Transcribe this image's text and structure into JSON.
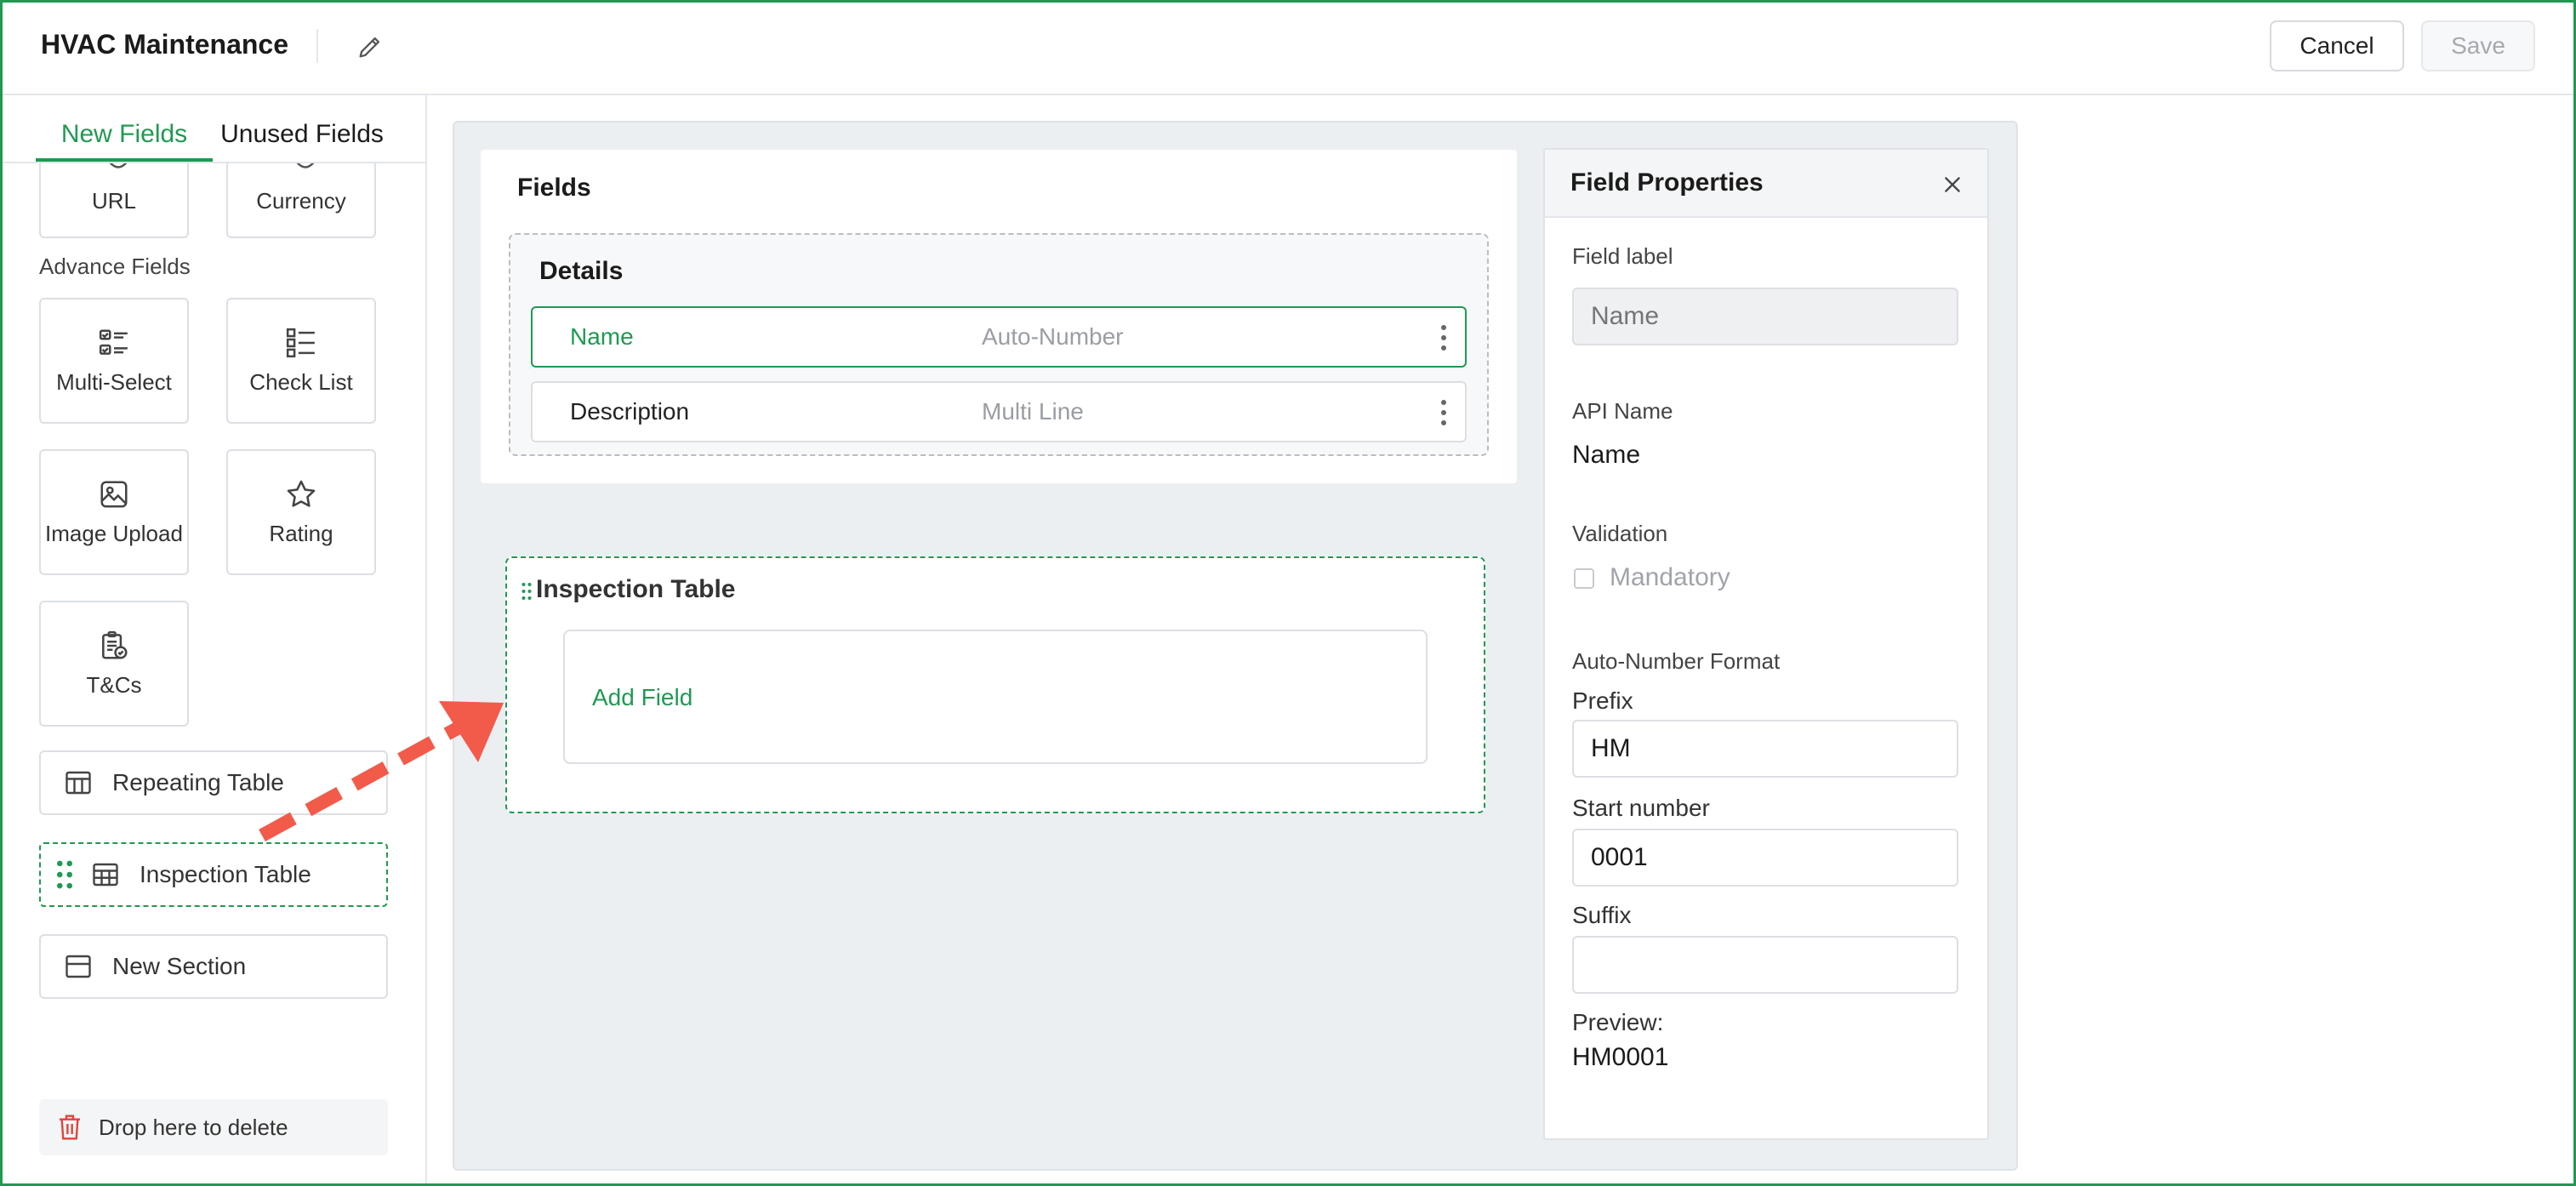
{
  "header": {
    "title": "HVAC Maintenance",
    "cancel_label": "Cancel",
    "save_label": "Save"
  },
  "left_panel": {
    "tabs": [
      {
        "label": "New Fields",
        "active": true
      },
      {
        "label": "Unused Fields",
        "active": false
      }
    ],
    "basic_tiles": [
      {
        "label": "URL",
        "icon": "link-icon"
      },
      {
        "label": "Currency",
        "icon": "currency-icon"
      }
    ],
    "advance_fields_heading": "Advance Fields",
    "advance_tiles": [
      {
        "label": "Multi-Select",
        "icon": "multi-select-icon"
      },
      {
        "label": "Check List",
        "icon": "check-list-icon"
      },
      {
        "label": "Image Upload",
        "icon": "image-icon"
      },
      {
        "label": "Rating",
        "icon": "star-icon"
      },
      {
        "label": "T&Cs",
        "icon": "terms-icon"
      }
    ],
    "wide_items": [
      {
        "label": "Repeating Table",
        "icon": "table-icon"
      },
      {
        "label": "Inspection Table",
        "icon": "grid-table-icon",
        "dragging": true
      },
      {
        "label": "New Section",
        "icon": "section-icon"
      }
    ],
    "delete_zone_label": "Drop here to delete"
  },
  "canvas": {
    "fields_title": "Fields",
    "details_title": "Details",
    "rows": [
      {
        "name": "Name",
        "type": "Auto-Number",
        "selected": true
      },
      {
        "name": "Description",
        "type": "Multi Line",
        "selected": false
      }
    ],
    "inspection_table": {
      "title": "Inspection Table",
      "add_field_label": "Add Field"
    }
  },
  "properties": {
    "title": "Field Properties",
    "field_label_heading": "Field label",
    "field_label_placeholder": "Name",
    "api_name_heading": "API Name",
    "api_name_value": "Name",
    "validation_heading": "Validation",
    "mandatory_label": "Mandatory",
    "auto_number_heading": "Auto-Number Format",
    "prefix_heading": "Prefix",
    "prefix_value": "HM",
    "start_number_heading": "Start number",
    "start_number_value": "0001",
    "suffix_heading": "Suffix",
    "suffix_value": "",
    "preview_heading": "Preview:",
    "preview_value": "HM0001"
  },
  "colors": {
    "accent": "#1f9a52",
    "arrow": "#f25a4a",
    "canvas_bg": "#eceff2"
  }
}
